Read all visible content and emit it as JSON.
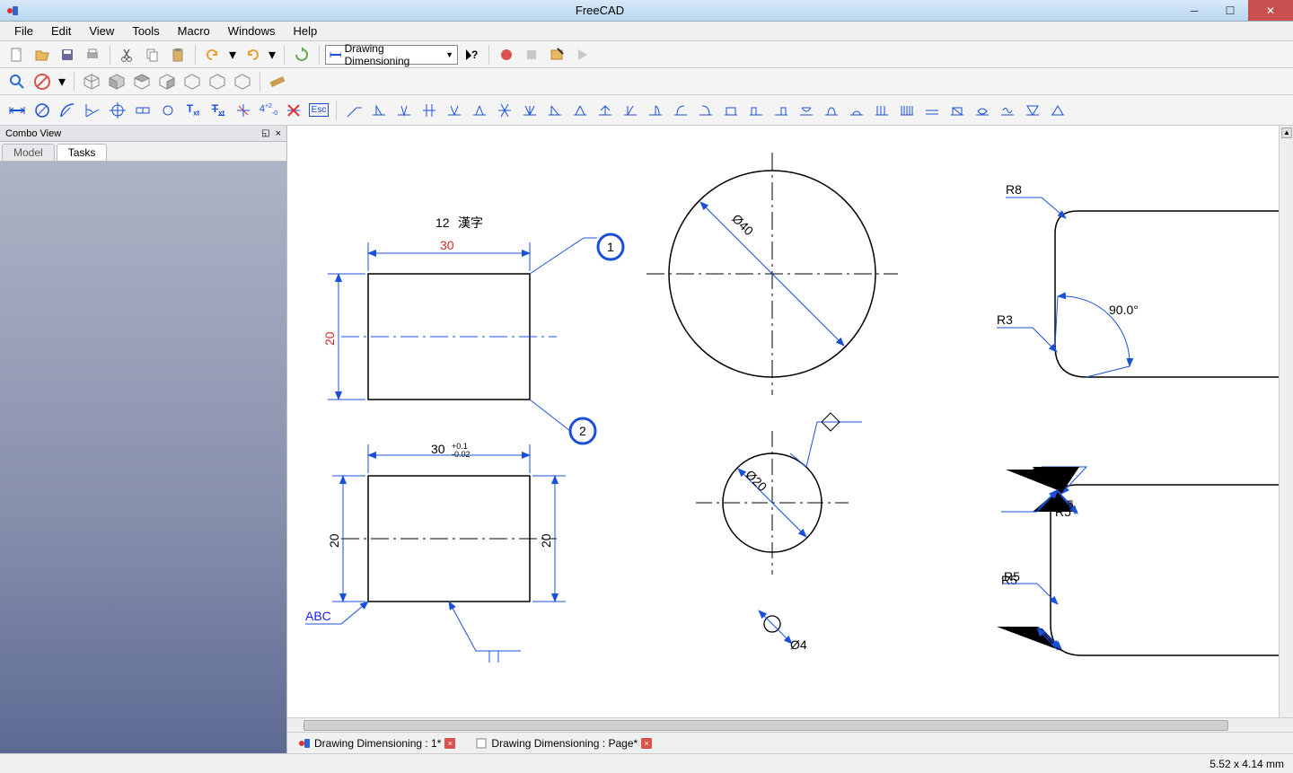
{
  "window": {
    "title": "FreeCAD"
  },
  "menu": {
    "file": "File",
    "edit": "Edit",
    "view": "View",
    "tools": "Tools",
    "macro": "Macro",
    "windows": "Windows",
    "help": "Help"
  },
  "workbench": {
    "selected": "Drawing Dimensioning"
  },
  "panel": {
    "title": "Combo View",
    "tab_model": "Model",
    "tab_tasks": "Tasks"
  },
  "doc_tabs": {
    "tab1": "Drawing Dimensioning : 1*",
    "tab2": "Drawing Dimensioning : Page*"
  },
  "status": {
    "coords": "5.52 x 4.14 mm"
  },
  "drawing": {
    "rect1": {
      "top_note_num": "12",
      "top_note_cjk": "漢字",
      "width_dim": "30",
      "height_dim": "20",
      "balloon1": "1",
      "balloon2": "2"
    },
    "rect2": {
      "width_dim": "30",
      "width_tol1": "+0.1",
      "width_tol2": "-0.02",
      "left_dim": "20",
      "right_dim": "20",
      "note_text": "ABC"
    },
    "circle1": {
      "dia": "Ø40"
    },
    "circle2": {
      "dia": "Ø20"
    },
    "circle3": {
      "dia": "Ø4"
    },
    "radii": {
      "r8": "R8",
      "r3": "R3",
      "angle": "90.0°",
      "r5a": "R5",
      "r5b": "R5"
    }
  }
}
